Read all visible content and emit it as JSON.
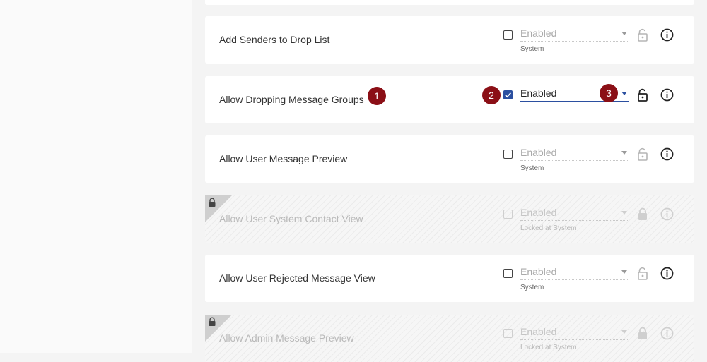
{
  "rows": [
    {
      "label": "Add Senders to Drop List",
      "checked": false,
      "value": "Enabled",
      "sub": "System",
      "locked": false
    },
    {
      "label": "Allow Dropping Message Groups",
      "checked": true,
      "value": "Enabled",
      "sub": "",
      "locked": false,
      "active": true
    },
    {
      "label": "Allow User Message Preview",
      "checked": false,
      "value": "Enabled",
      "sub": "System",
      "locked": false
    },
    {
      "label": "Allow User System Contact View",
      "checked": false,
      "value": "Enabled",
      "sub": "Locked at System",
      "locked": true
    },
    {
      "label": "Allow User Rejected Message View",
      "checked": false,
      "value": "Enabled",
      "sub": "System",
      "locked": false
    },
    {
      "label": "Allow Admin Message Preview",
      "checked": false,
      "value": "Enabled",
      "sub": "Locked at System",
      "locked": true
    }
  ],
  "badges": {
    "one": "1",
    "two": "2",
    "three": "3"
  },
  "colors": {
    "accent": "#2b4fa0",
    "badge": "#8b0f16"
  },
  "icons": {
    "lock": "lock-icon",
    "info": "info-icon",
    "caret": "caret-down-icon",
    "check": "check-icon"
  }
}
